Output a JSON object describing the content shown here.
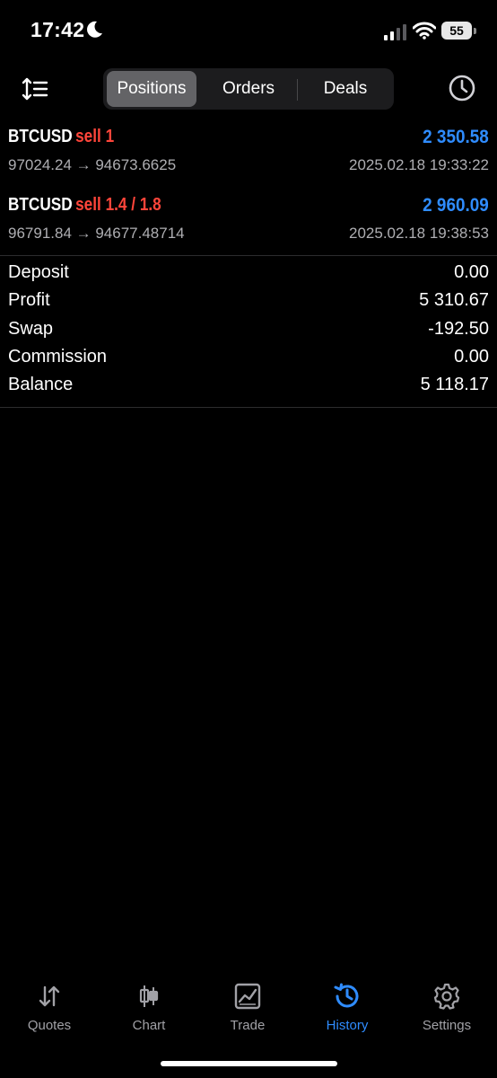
{
  "status_bar": {
    "time": "17:42",
    "battery": "55"
  },
  "segments": [
    {
      "label": "Positions",
      "active": true
    },
    {
      "label": "Orders",
      "active": false
    },
    {
      "label": "Deals",
      "active": false
    }
  ],
  "positions": [
    {
      "symbol": "BTCUSD",
      "side": "sell 1",
      "profit": "2 350.58",
      "prices": "97024.24 → 94673.6625",
      "time": "2025.02.18 19:33:22"
    },
    {
      "symbol": "BTCUSD",
      "side": "sell 1.4 / 1.8",
      "profit": "2 960.09",
      "prices": "96791.84 → 94677.48714",
      "time": "2025.02.18 19:38:53"
    }
  ],
  "summary": [
    {
      "label": "Deposit",
      "value": "0.00"
    },
    {
      "label": "Profit",
      "value": "5 310.67"
    },
    {
      "label": "Swap",
      "value": "-192.50"
    },
    {
      "label": "Commission",
      "value": "0.00"
    },
    {
      "label": "Balance",
      "value": "5 118.17"
    }
  ],
  "tabs": [
    {
      "label": "Quotes",
      "icon": "quotes-arrows-icon"
    },
    {
      "label": "Chart",
      "icon": "candlestick-icon"
    },
    {
      "label": "Trade",
      "icon": "trade-chart-icon"
    },
    {
      "label": "History",
      "icon": "history-icon",
      "active": true
    },
    {
      "label": "Settings",
      "icon": "gear-icon"
    }
  ],
  "colors": {
    "accent": "#2f8cff",
    "sell": "#ff453a",
    "background": "#000000",
    "secondary_text": "#aeaeb2"
  }
}
